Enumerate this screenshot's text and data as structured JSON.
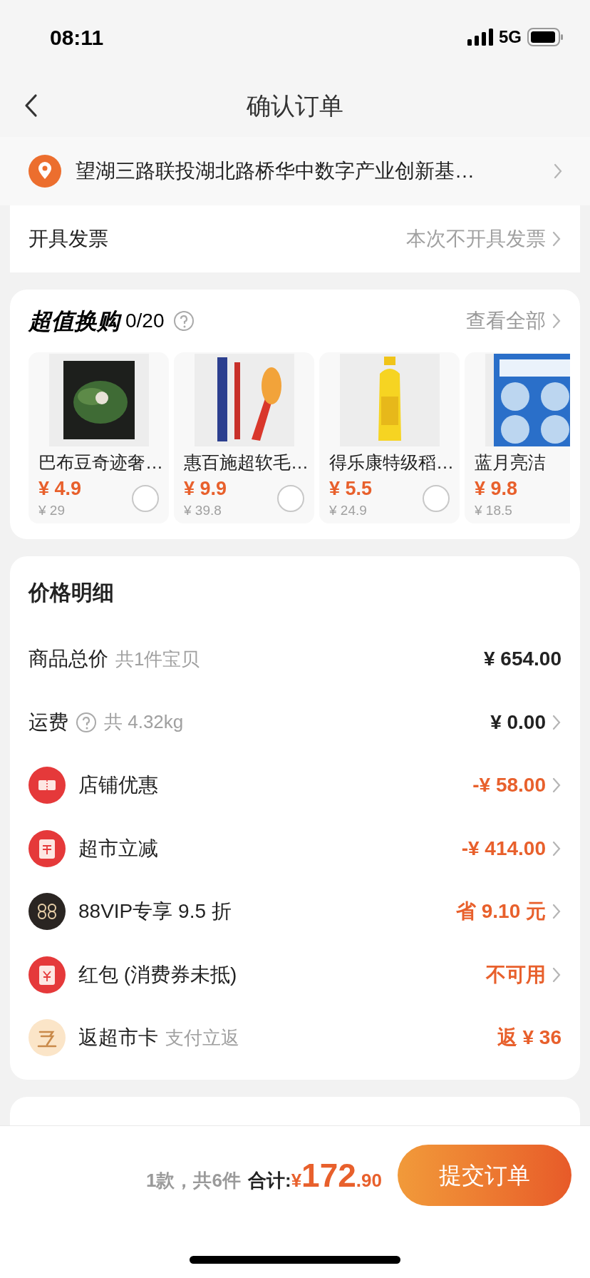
{
  "status_bar": {
    "time": "08:11",
    "network": "5G"
  },
  "nav": {
    "title": "确认订单"
  },
  "address": {
    "text": "望湖三路联投湖北路桥华中数字产业创新基…"
  },
  "invoice": {
    "label": "开具发票",
    "value": "本次不开具发票"
  },
  "exchange": {
    "title": "超值换购",
    "count": "0/20",
    "more": "查看全部",
    "items": [
      {
        "name": "巴布豆奇迹奢…",
        "price": "¥ 4.9",
        "original": "¥ 29",
        "selected": false
      },
      {
        "name": "惠百施超软毛…",
        "price": "¥ 9.9",
        "original": "¥ 39.8",
        "selected": false
      },
      {
        "name": "得乐康特级稻…",
        "price": "¥ 5.5",
        "original": "¥ 24.9",
        "selected": false
      },
      {
        "name": "蓝月亮洁",
        "price": "¥ 9.8",
        "original": "¥ 18.5"
      }
    ]
  },
  "price_detail": {
    "title": "价格明细",
    "rows": [
      {
        "kind": "total",
        "label": "商品总价",
        "note": "共1件宝贝",
        "value": "¥ 654.00"
      },
      {
        "kind": "shipping",
        "label": "运费",
        "note": "共 4.32kg",
        "value": "¥ 0.00"
      },
      {
        "kind": "coupon",
        "label": "店铺优惠",
        "value": "-¥ 58.00"
      },
      {
        "kind": "reduction",
        "label": "超市立减",
        "value": "-¥ 414.00"
      },
      {
        "kind": "vip",
        "label": "88VIP专享 9.5 折",
        "value": "省 9.10 元"
      },
      {
        "kind": "envelope",
        "label": "红包 (消费券未抵)",
        "value": "不可用"
      },
      {
        "kind": "cashback",
        "label": "返超市卡",
        "note": "支付立返",
        "value": "返 ¥ 36"
      }
    ]
  },
  "footer": {
    "count": "1款，共6件",
    "label": "合计:",
    "currency": "¥",
    "integer": "172",
    "decimal": ".90",
    "submit": "提交订单"
  }
}
